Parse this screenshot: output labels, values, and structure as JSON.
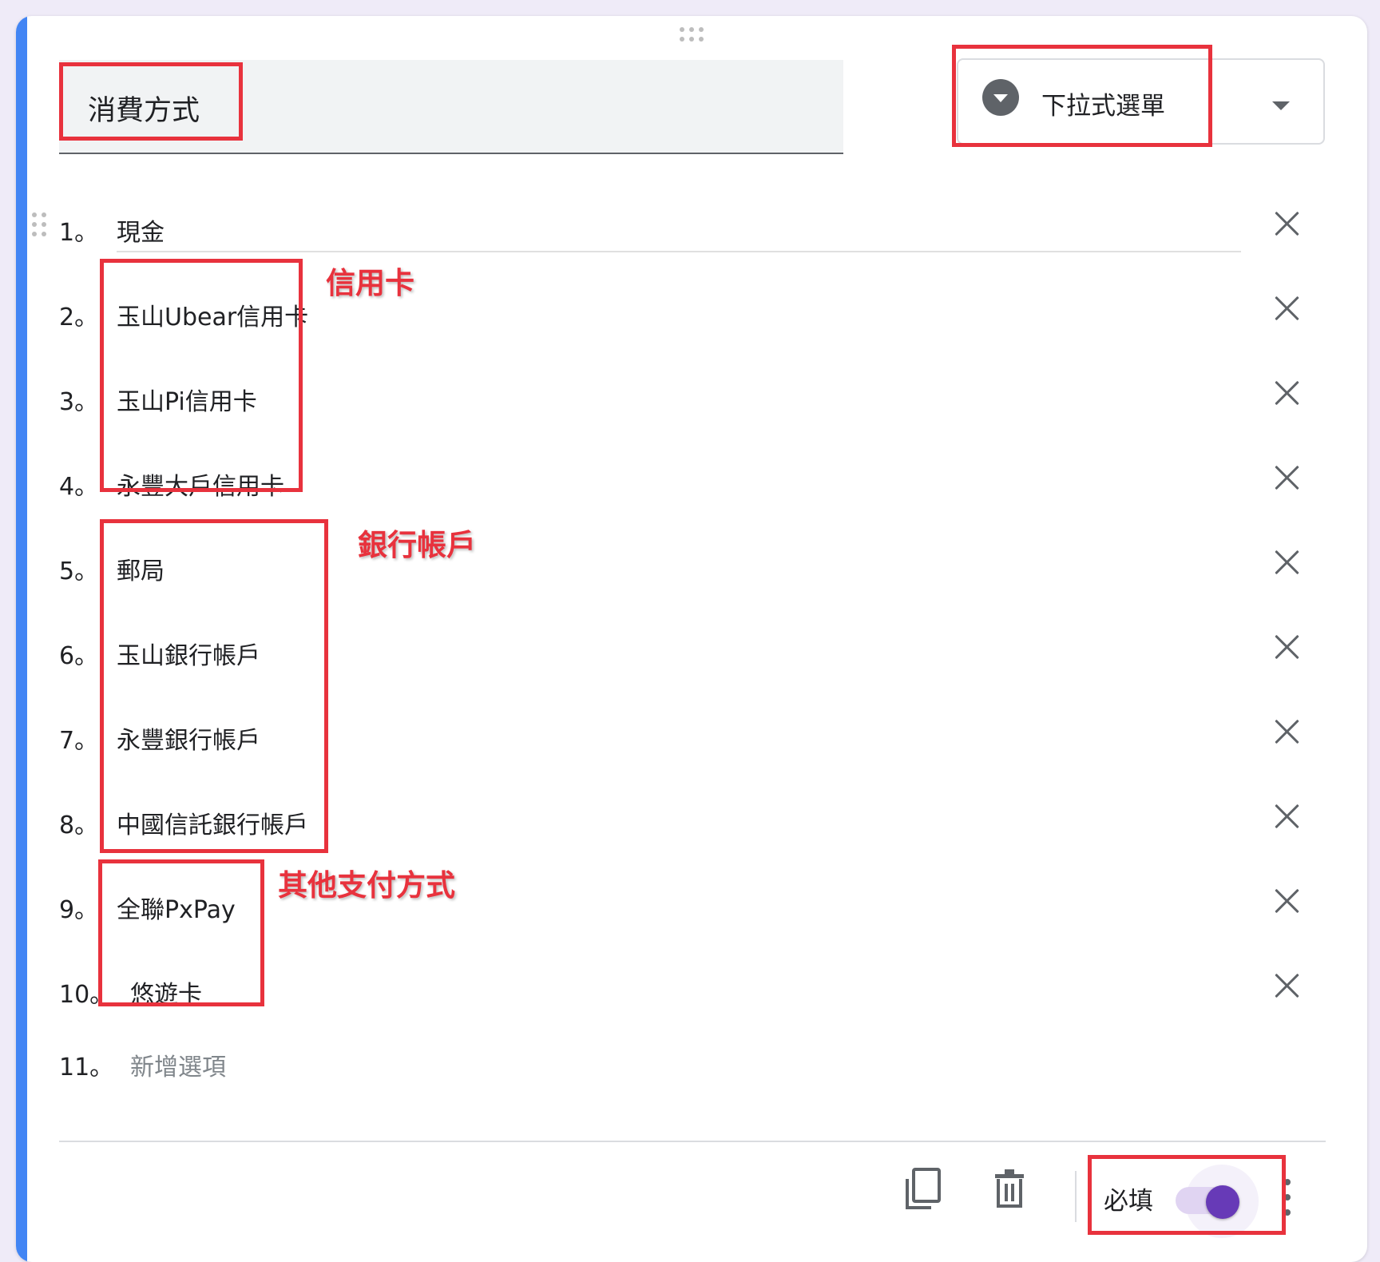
{
  "question": {
    "title": "消費方式",
    "type_label": "下拉式選單"
  },
  "options": [
    {
      "num": "1。",
      "label": "現金"
    },
    {
      "num": "2。",
      "label": "玉山Ubear信用卡"
    },
    {
      "num": "3。",
      "label": "玉山Pi信用卡"
    },
    {
      "num": "4。",
      "label": "永豐大戶信用卡"
    },
    {
      "num": "5。",
      "label": "郵局"
    },
    {
      "num": "6。",
      "label": "玉山銀行帳戶"
    },
    {
      "num": "7。",
      "label": "永豐銀行帳戶"
    },
    {
      "num": "8。",
      "label": "中國信託銀行帳戶"
    },
    {
      "num": "9。",
      "label": "全聯PxPay"
    },
    {
      "num": "10。",
      "label": "悠遊卡"
    }
  ],
  "add_option": {
    "num": "11。",
    "label": "新增選項"
  },
  "footer": {
    "required_label": "必填",
    "required_on": true
  },
  "annotations": {
    "credit_card": "信用卡",
    "bank_account": "銀行帳戶",
    "other_payment": "其他支付方式"
  },
  "icons": {
    "drag_handle": "drag-handle-icon",
    "type_icon": "dropdown-circle-icon",
    "caret": "caret-down-icon",
    "remove": "close-icon",
    "copy": "copy-icon",
    "delete": "trash-icon",
    "more": "more-vert-icon"
  },
  "colors": {
    "accent_bar": "#4285f4",
    "toggle_on": "#673ab7",
    "annotation_red": "#e8323d"
  }
}
